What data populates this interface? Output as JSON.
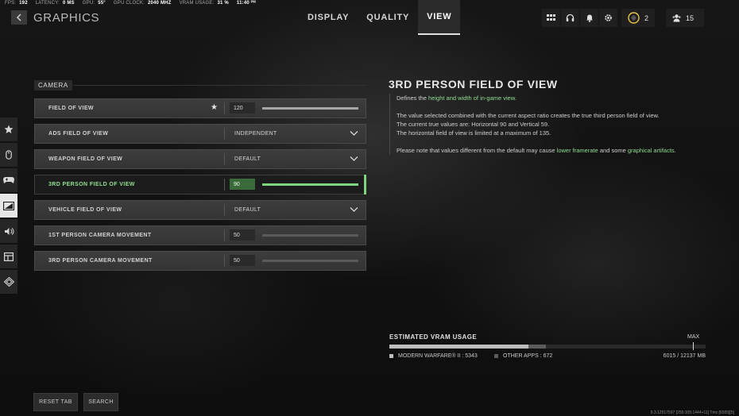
{
  "stats": [
    {
      "label": "FPS:",
      "value": "192"
    },
    {
      "label": "LATENCY:",
      "value": "0 MS"
    },
    {
      "label": "GPU:",
      "value": "55°"
    },
    {
      "label": "GPU CLOCK:",
      "value": "2040 MHZ"
    },
    {
      "label": "VRAM USAGE:",
      "value": "31 %"
    },
    {
      "label": "",
      "value": "11:40 ᴾᴹ"
    }
  ],
  "header": {
    "title": "GRAPHICS",
    "tabs": [
      "DISPLAY",
      "QUALITY",
      "VIEW"
    ],
    "active_tab": "VIEW",
    "notifications_count": "2",
    "party_count": "15"
  },
  "section": {
    "label": "CAMERA"
  },
  "settings": [
    {
      "label": "FIELD OF VIEW",
      "value": "120",
      "fill": 1.0
    },
    {
      "label": "ADS FIELD OF VIEW",
      "value": "INDEPENDENT"
    },
    {
      "label": "WEAPON FIELD OF VIEW",
      "value": "DEFAULT"
    },
    {
      "label": "3RD PERSON FIELD OF VIEW",
      "value": "90",
      "fill": 1.0
    },
    {
      "label": "VEHICLE FIELD OF VIEW",
      "value": "DEFAULT"
    },
    {
      "label": "1ST PERSON CAMERA MOVEMENT",
      "value": "50",
      "fill": 0.0
    },
    {
      "label": "3RD PERSON CAMERA MOVEMENT",
      "value": "50",
      "fill": 0.0
    }
  ],
  "description": {
    "title": "3RD PERSON FIELD OF VIEW",
    "p1_pre": "Defines the ",
    "p1_hl": "height and width of in-game view.",
    "p2_l1": "The value selected combined with the current aspect ratio creates the true third person field of view.",
    "p2_l2": "The current true values are: Horizontal 90 and Vertical 59.",
    "p2_l3": "The horizontal field of view is limited at a maximum of 135.",
    "p3_pre": "Please note that values different from the default may cause ",
    "p3_hl1": "lower framerate",
    "p3_mid": " and some ",
    "p3_hl2": "graphical artifacts",
    "p3_end": "."
  },
  "vram": {
    "title": "ESTIMATED VRAM USAGE",
    "max_label": "MAX",
    "game_label": "MODERN WARFARE® II : 5343",
    "other_label": "OTHER APPS : 672",
    "total_label": "6015 / 12137 MB",
    "game_mb": 5343,
    "other_mb": 672,
    "total_mb": 12137,
    "game_color": "#bdbdbd",
    "other_color": "#5b5b5b"
  },
  "buttons": {
    "reset": "RESET TAB",
    "search": "SEARCH"
  },
  "build": "9.3.12517597 [255:105:1444+11] Tmc [6555][5]",
  "colors": {
    "accent": "#7cd67c",
    "accent_text": "#8fdc8f"
  }
}
